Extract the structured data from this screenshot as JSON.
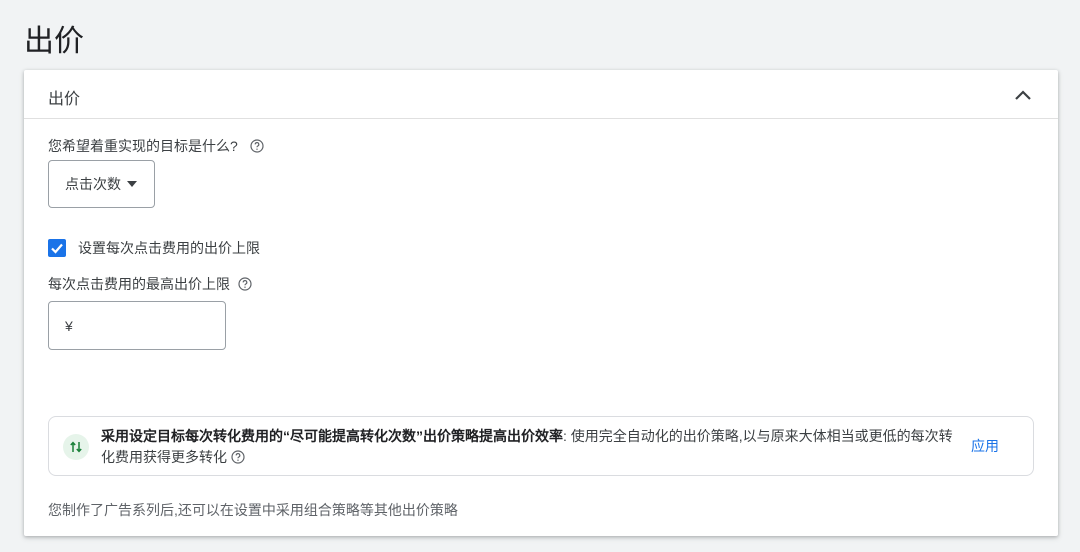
{
  "page": {
    "title": "出价"
  },
  "card": {
    "header_title": "出价",
    "goal_question": "您希望着重实现的目标是什么?",
    "goal_dropdown": {
      "selected": "点击次数"
    },
    "cpc_limit_checkbox": {
      "label": "设置每次点击费用的出价上限",
      "checked": true
    },
    "max_cpc_label": "每次点击费用的最高出价上限",
    "max_cpc_input": {
      "currency": "¥",
      "value": ""
    },
    "recommendation": {
      "bold_text": "采用设定目标每次转化费用的“尽可能提高转化次数”出价策略提高出价效率",
      "separator": ":",
      "body_text": "使用完全自动化的出价策略,以与原来大体相当或更低的每次转化费用获得更多转化",
      "apply_label": "应用"
    },
    "footer_note": "您制作了广告系列后,还可以在设置中采用组合策略等其他出价策略"
  },
  "colors": {
    "accent": "#1a73e8",
    "reco_icon_bg": "#e6f4ea",
    "reco_icon_fg": "#188038"
  }
}
